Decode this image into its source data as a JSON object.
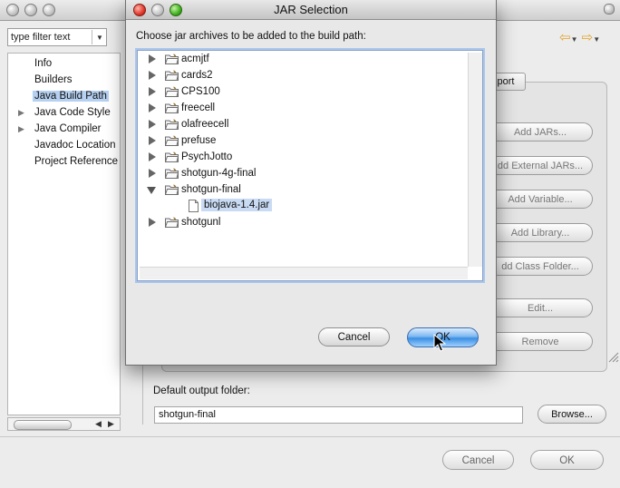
{
  "background_window": {
    "filter_placeholder": "type filter text",
    "nav_items": [
      {
        "label": "Info",
        "expandable": false,
        "selected": false
      },
      {
        "label": "Builders",
        "expandable": false,
        "selected": false
      },
      {
        "label": "Java Build Path",
        "expandable": false,
        "selected": true
      },
      {
        "label": "Java Code Style",
        "expandable": true,
        "selected": false
      },
      {
        "label": "Java Compiler",
        "expandable": true,
        "selected": false
      },
      {
        "label": "Javadoc Location",
        "expandable": false,
        "selected": false
      },
      {
        "label": "Project Reference",
        "expandable": false,
        "selected": false
      }
    ],
    "visible_tab_fragment": "port",
    "side_buttons": [
      "Add JARs...",
      "dd External JARs...",
      "Add Variable...",
      "Add Library...",
      "dd Class Folder...",
      "Edit...",
      "Remove"
    ],
    "output_folder_label": "Default output folder:",
    "output_folder_value": "shotgun-final",
    "browse_label": "Browse...",
    "cancel_label": "Cancel",
    "ok_label": "OK"
  },
  "dialog": {
    "title": "JAR Selection",
    "prompt": "Choose jar archives to be added to the build path:",
    "tree": [
      {
        "label": "acmjtf",
        "expanded": false
      },
      {
        "label": "cards2",
        "expanded": false
      },
      {
        "label": "CPS100",
        "expanded": false
      },
      {
        "label": "freecell",
        "expanded": false
      },
      {
        "label": "olafreecell",
        "expanded": false
      },
      {
        "label": "prefuse",
        "expanded": false
      },
      {
        "label": "PsychJotto",
        "expanded": false
      },
      {
        "label": "shotgun-4g-final",
        "expanded": false
      },
      {
        "label": "shotgun-final",
        "expanded": true,
        "children": [
          {
            "label": "biojava-1.4.jar",
            "selected": true
          }
        ]
      },
      {
        "label": "shotgunl",
        "expanded": false
      }
    ],
    "cancel_label": "Cancel",
    "ok_label": "OK"
  },
  "colors": {
    "selection": "#c9dbf4",
    "ok_button": "#3a8fe3",
    "close_button": "#e0362a",
    "zoom_button": "#3fb11d"
  }
}
